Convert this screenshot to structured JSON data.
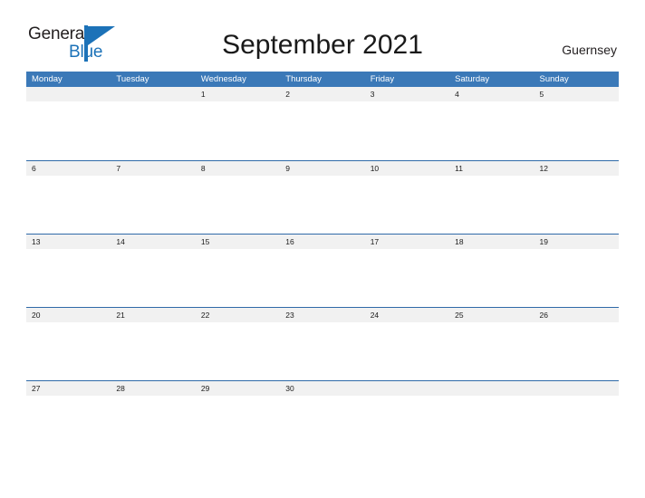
{
  "brand": {
    "name_part1": "General",
    "name_part2": "Blue",
    "logo_icon": "flag-triangle-icon",
    "color_primary": "#1c72b8",
    "color_text": "#231f20"
  },
  "header": {
    "title": "September 2021",
    "locale": "Guernsey"
  },
  "calendar": {
    "header_bg": "#3b79b8",
    "date_strip_bg": "#f1f1f1",
    "rule_color": "#2f6aa8",
    "weekdays": [
      "Monday",
      "Tuesday",
      "Wednesday",
      "Thursday",
      "Friday",
      "Saturday",
      "Sunday"
    ],
    "weeks": [
      {
        "rule": false,
        "days": [
          "",
          "",
          "1",
          "2",
          "3",
          "4",
          "5"
        ]
      },
      {
        "rule": true,
        "days": [
          "6",
          "7",
          "8",
          "9",
          "10",
          "11",
          "12"
        ]
      },
      {
        "rule": true,
        "days": [
          "13",
          "14",
          "15",
          "16",
          "17",
          "18",
          "19"
        ]
      },
      {
        "rule": true,
        "days": [
          "20",
          "21",
          "22",
          "23",
          "24",
          "25",
          "26"
        ]
      },
      {
        "rule": true,
        "days": [
          "27",
          "28",
          "29",
          "30",
          "",
          "",
          ""
        ]
      }
    ]
  }
}
